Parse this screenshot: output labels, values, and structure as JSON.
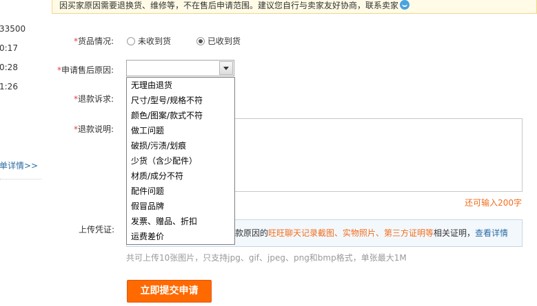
{
  "notice": {
    "text": "因买家原因需要退换货、维修等，不在售后申请范围。建议您自行与卖家友好协商，联系卖家"
  },
  "sidebar": {
    "fragments": [
      "33500",
      "0:17",
      "0:28",
      "1:26"
    ],
    "detail_link": "单详情>>"
  },
  "form": {
    "goods_status": {
      "required": "*",
      "label": "货品情况:",
      "options": [
        {
          "label": "未收到货",
          "checked": false
        },
        {
          "label": "已收到货",
          "checked": true
        }
      ]
    },
    "reason": {
      "required": "*",
      "label": "申请售后原因:",
      "selected": "",
      "options": [
        "无理由退货",
        "尺寸/型号/规格不符",
        "颜色/图案/款式不符",
        "做工问题",
        "破损/污渍/划痕",
        "少货（含少配件）",
        "材质/成分不符",
        "配件问题",
        "假冒品牌",
        "发票、赠品、折扣",
        "运费差价"
      ]
    },
    "refund_claim": {
      "required": "*",
      "label": "退款诉求:"
    },
    "refund_desc": {
      "required": "*",
      "label": "退款说明:",
      "remaining": "还可输入200字"
    },
    "upload": {
      "label": "上传凭证:",
      "text_prefix": "款原因的",
      "text_orange": "旺旺聊天记录截图、实物照片、第三方证明等",
      "text_mid": "相关证明，",
      "text_link": "查看详情",
      "hint": "共可上传10张图片，只支持jpg、gif、jpeg、png和bmp格式，单张最大1M"
    },
    "submit_label": "立即提交申请"
  }
}
